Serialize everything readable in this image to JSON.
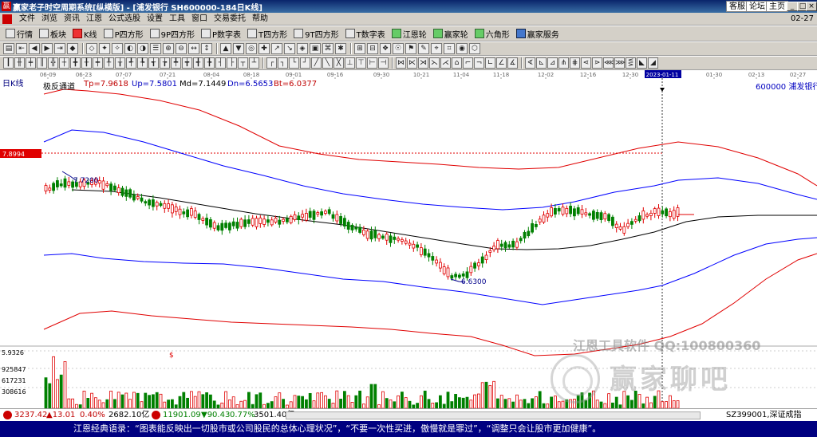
{
  "window": {
    "title": "赢家老子时空周期系统[纵横版] - [浦发银行  SH600000-184日K线]",
    "top_links": [
      "客服",
      "论坛",
      "主页"
    ],
    "controls": [
      "_",
      "□",
      "×"
    ]
  },
  "menu": {
    "items": [
      "文件",
      "浏览",
      "资讯",
      "江恩",
      "公式选股",
      "设置",
      "工具",
      "窗口",
      "交易委托",
      "帮助"
    ],
    "right_text": "02-27"
  },
  "toolbar1": [
    {
      "label": "行情",
      "icon": "grid-icon",
      "style": ""
    },
    {
      "label": "板块",
      "icon": "blocks-icon",
      "style": ""
    },
    {
      "label": "K线",
      "icon": "kline-icon",
      "style": "red"
    },
    {
      "label": "P四方形",
      "icon": "p-square-icon",
      "style": ""
    },
    {
      "label": "9P四方形",
      "icon": "9p-square-icon",
      "style": ""
    },
    {
      "label": "P数字表",
      "icon": "p-number-table-icon",
      "style": ""
    },
    {
      "label": "T四方形",
      "icon": "t-square-icon",
      "style": ""
    },
    {
      "label": "9T四方形",
      "icon": "9t-square-icon",
      "style": ""
    },
    {
      "label": "T数字表",
      "icon": "t-number-table-icon",
      "style": ""
    },
    {
      "label": "江恩轮",
      "icon": "gann-wheel-icon",
      "style": "green"
    },
    {
      "label": "赢家轮",
      "icon": "winner-wheel-icon",
      "style": "green"
    },
    {
      "label": "六角形",
      "icon": "hexagon-icon",
      "style": "green"
    },
    {
      "label": "赢家服务",
      "icon": "service-icon",
      "style": "blue"
    }
  ],
  "header": {
    "period": "日K线",
    "indicator_name": "极反通道",
    "tp": "Tp=7.9618",
    "up": "Up=7.5801",
    "md": "Md=7.1449",
    "dn": "Dn=6.5653",
    "bt": "Bt=6.0377",
    "stock": "600000  浦发银行",
    "crosshair_date": "2023-01-11",
    "price_label": "7.8994"
  },
  "chart_data": {
    "type": "candlestick",
    "date_ticks": [
      "06-09",
      "06-23",
      "07-07",
      "07-21",
      "08-04",
      "08-18",
      "09-01",
      "09-16",
      "09-30",
      "10-21",
      "11-04",
      "11-18",
      "12-02",
      "12-16",
      "12-30",
      "2023-01-11",
      "01-30",
      "02-13",
      "02-27"
    ],
    "annotations": {
      "high": "7.7200",
      "low": "6.6300"
    },
    "volume_ticks": [
      "5.9326",
      "925847",
      "617231",
      "308616"
    ],
    "volume_marker": "$",
    "colors": {
      "up": "#e00000",
      "down": "#008000",
      "tp": "#e00000",
      "up_band": "#0000ff",
      "md": "#000000",
      "dn": "#0000ff",
      "bt": "#e00000"
    }
  },
  "indexbar": {
    "sh_value": "3237.42",
    "sh_change": "▲13.01",
    "sh_pct": "0.40%",
    "sh_amount": "2682.10亿",
    "sz_value": "11901.09",
    "sz_change": "▼90.43",
    "sz_pct": "0.77%",
    "sz_amount": "3501.40亿",
    "right_label": "SZ399001,深证成指"
  },
  "watermark": {
    "company": "江恩工具软件  QQ:100800360",
    "brand": "赢家聊吧"
  },
  "footer": {
    "quote": "江恩经典语录：“图表能反映出一切股市或公司股民的总体心理状况”，“不要一次性买进，傲慢就是罪过”，“调整只会让股市更加健康”。"
  }
}
